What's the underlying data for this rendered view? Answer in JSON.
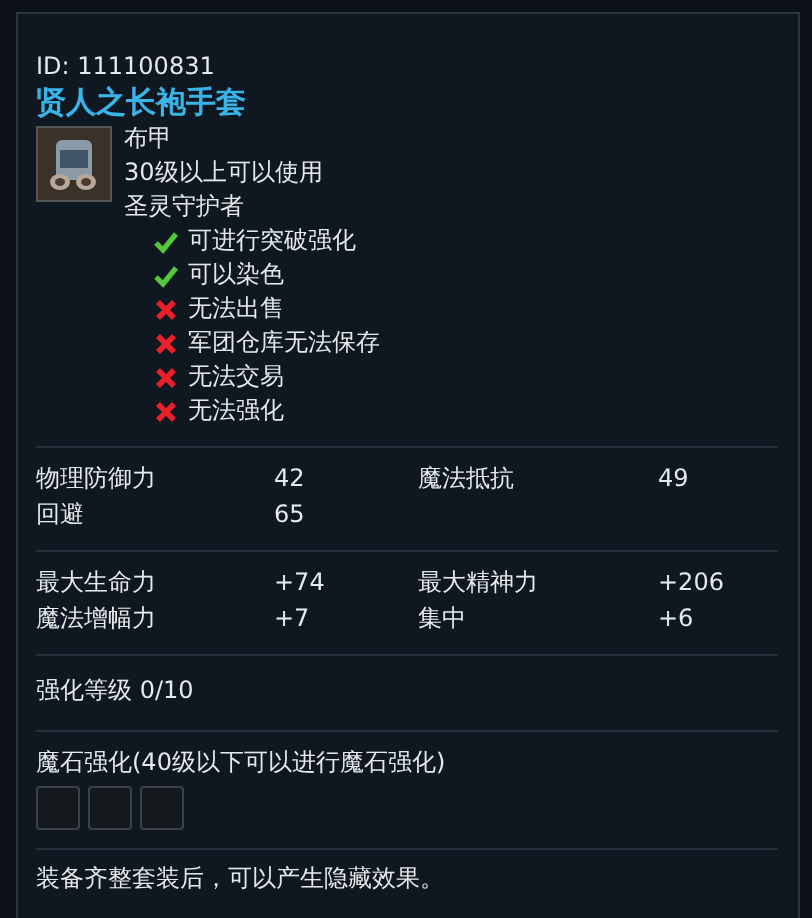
{
  "item_id": "ID: 111100831",
  "name": "贤人之长袍手套",
  "info": [
    "布甲",
    "30级以上可以使用",
    "圣灵守护者"
  ],
  "flags": [
    {
      "label": "可进行突破强化",
      "allowed": true
    },
    {
      "label": "可以染色",
      "allowed": true
    },
    {
      "label": "无法出售",
      "allowed": false
    },
    {
      "label": "军团仓库无法保存",
      "allowed": false
    },
    {
      "label": "无法交易",
      "allowed": false
    },
    {
      "label": "无法强化",
      "allowed": false
    }
  ],
  "stat_groups": [
    [
      {
        "name": "物理防御力",
        "value": "42"
      },
      {
        "name": "魔法抵抗",
        "value": "49"
      },
      {
        "name": "回避",
        "value": "65"
      }
    ],
    [
      {
        "name": "最大生命力",
        "value": "+74"
      },
      {
        "name": "最大精神力",
        "value": "+206"
      },
      {
        "name": "魔法增幅力",
        "value": "+7"
      },
      {
        "name": "集中",
        "value": "+6"
      }
    ]
  ],
  "enchant_level": "强化等级 0/10",
  "manastone": {
    "label": "魔石强化(40级以下可以进行魔石强化)",
    "slots": [
      {
        "filled": false
      },
      {
        "filled": false
      },
      {
        "filled": false
      }
    ]
  },
  "set_note": "装备齐整套装后，可以产生隐藏效果。"
}
